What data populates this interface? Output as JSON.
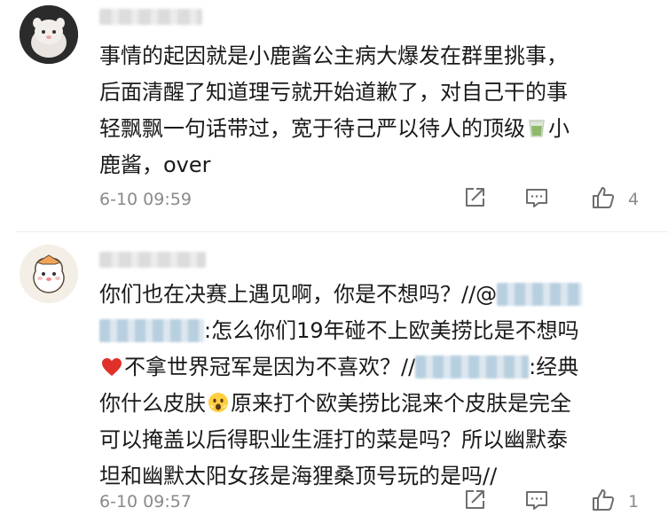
{
  "comments": [
    {
      "lines": [
        [
          "事情的起因就是小鹿酱公主病大爆发在群里挑事，"
        ],
        [
          "后面清醒了知道理亏就开始道歉了，对自己干的事"
        ],
        [
          "轻飘飘一句话带过，宽于待己严以待人的顶级",
          "小"
        ],
        [
          "鹿酱，over"
        ]
      ],
      "time": "6-10 09:59",
      "likes": "4"
    },
    {
      "lines": [
        [
          "你们也在决赛上遇见啊，你是不想吗？//@"
        ],
        [
          ":怎么你们19年碰不上欧美捞比是不想吗"
        ],
        [
          "不拿世界冠军是因为不喜欢？//",
          ":经典"
        ],
        [
          "你什么皮肤",
          "原来打个欧美捞比混来个皮肤是完全"
        ],
        [
          "可以掩盖以后得职业生涯打的菜是吗？所以幽默泰"
        ],
        [
          "坦和幽默太阳女孩是海狸桑顶号玩的是吗//"
        ]
      ],
      "time": "6-10 09:57",
      "likes": "1"
    }
  ],
  "icons": {
    "share": "share-icon",
    "reply": "comment-icon",
    "like": "thumbs-up-icon",
    "emoji_tea": "tea-emoji",
    "emoji_heart": "heart-emoji",
    "emoji_face": "face-emoji"
  },
  "colors": {
    "meta_text": "#8a8a8a",
    "body_text": "#1a1a1a",
    "heart": "#e0302a"
  }
}
